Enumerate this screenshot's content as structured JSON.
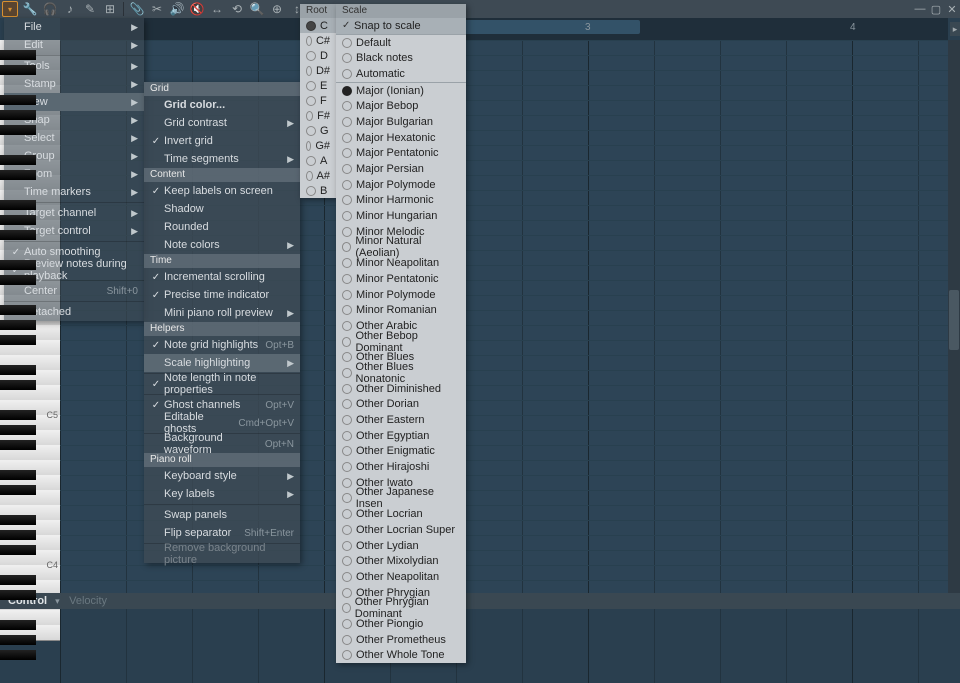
{
  "toolbar_icons": [
    "▾",
    "🔧",
    "🎧",
    "♪",
    "✎",
    "⊞",
    "",
    "📎",
    "✂",
    "🔊",
    "🔇",
    "↔",
    "⟲",
    "🔍",
    "⊕",
    "↕"
  ],
  "window_buttons": [
    "—",
    "▢",
    "✕"
  ],
  "ruler": {
    "marker": "",
    "beats": [
      "3",
      "4"
    ]
  },
  "sidebar_chevron": "▸",
  "key_labels": {
    "c5": "C5",
    "c4": "C4"
  },
  "control": {
    "label": "Control",
    "dd": "▾",
    "sub": "Velocity"
  },
  "menu1": [
    {
      "label": "File",
      "arrow": true
    },
    {
      "label": "Edit",
      "arrow": true,
      "icon": "✎"
    },
    {
      "sep": true
    },
    {
      "label": "Tools",
      "arrow": true
    },
    {
      "label": "Stamp",
      "arrow": true
    },
    {
      "label": "View",
      "arrow": true,
      "hl": true
    },
    {
      "label": "Snap",
      "arrow": true
    },
    {
      "label": "Select",
      "arrow": true
    },
    {
      "label": "Group",
      "arrow": true
    },
    {
      "label": "Zoom",
      "arrow": true
    },
    {
      "label": "Time markers",
      "arrow": true
    },
    {
      "sep": true
    },
    {
      "label": "Target channel",
      "arrow": true
    },
    {
      "label": "Target control",
      "arrow": true
    },
    {
      "sep": true
    },
    {
      "label": "Auto smoothing",
      "check": true
    },
    {
      "label": "Preview notes during playback",
      "check": true
    },
    {
      "sep": true
    },
    {
      "label": "Center",
      "shortcut": "Shift+0"
    },
    {
      "sep": true
    },
    {
      "label": "Detached"
    }
  ],
  "menu2": [
    {
      "hdr": "Grid"
    },
    {
      "label": "Grid color...",
      "bold": true
    },
    {
      "label": "Grid contrast",
      "arrow": true
    },
    {
      "label": "Invert grid",
      "check": true
    },
    {
      "label": "Time segments",
      "arrow": true
    },
    {
      "hdr": "Content"
    },
    {
      "label": "Keep labels on screen",
      "check": true
    },
    {
      "label": "Shadow"
    },
    {
      "label": "Rounded"
    },
    {
      "label": "Note colors",
      "arrow": true
    },
    {
      "hdr": "Time"
    },
    {
      "label": "Incremental scrolling",
      "check": true
    },
    {
      "label": "Precise time indicator",
      "check": true
    },
    {
      "label": "Mini piano roll preview",
      "arrow": true
    },
    {
      "hdr": "Helpers"
    },
    {
      "label": "Note grid highlights",
      "check": true,
      "shortcut": "Opt+B"
    },
    {
      "label": "Scale highlighting",
      "arrow": true,
      "hl": true
    },
    {
      "sep": true
    },
    {
      "label": "Note length in note properties",
      "check": true
    },
    {
      "sep": true
    },
    {
      "label": "Ghost channels",
      "check": true,
      "shortcut": "Opt+V"
    },
    {
      "label": "Editable ghosts",
      "shortcut": "Cmd+Opt+V"
    },
    {
      "sep": true
    },
    {
      "label": "Background waveform",
      "shortcut": "Opt+N"
    },
    {
      "hdr": "Piano roll"
    },
    {
      "label": "Keyboard style",
      "arrow": true
    },
    {
      "label": "Key labels",
      "arrow": true
    },
    {
      "sep": true
    },
    {
      "label": "Swap panels"
    },
    {
      "label": "Flip separator",
      "shortcut": "Shift+Enter"
    },
    {
      "sep": true
    },
    {
      "label": "Remove background picture",
      "dis": true
    }
  ],
  "menu3_hdr": "Root note",
  "menu3": [
    "C",
    "C#",
    "D",
    "D#",
    "E",
    "F",
    "F#",
    "G",
    "G#",
    "A",
    "A#",
    "B"
  ],
  "menu3_sel": "C",
  "menu4_hdr": "Scale",
  "menu4_top": {
    "label": "Snap to scale",
    "check": true
  },
  "menu4": [
    "Default",
    "Black notes",
    "Automatic",
    "__sep",
    "Major (Ionian)",
    "Major Bebop",
    "Major Bulgarian",
    "Major Hexatonic",
    "Major Pentatonic",
    "Major Persian",
    "Major Polymode",
    "Minor Harmonic",
    "Minor Hungarian",
    "Minor Melodic",
    "Minor Natural (Aeolian)",
    "Minor Neapolitan",
    "Minor Pentatonic",
    "Minor Polymode",
    "Minor Romanian",
    "Other Arabic",
    "Other Bebop Dominant",
    "Other Blues",
    "Other Blues Nonatonic",
    "Other Diminished",
    "Other Dorian",
    "Other Eastern",
    "Other Egyptian",
    "Other Enigmatic",
    "Other Hirajoshi",
    "Other Iwato",
    "Other Japanese Insen",
    "Other Locrian",
    "Other Locrian Super",
    "Other Lydian",
    "Other Mixolydian",
    "Other Neapolitan",
    "Other Phrygian",
    "Other Phrygian Dominant",
    "Other Piongio",
    "Other Prometheus",
    "Other Whole Tone"
  ],
  "menu4_sel": "Major (Ionian)"
}
